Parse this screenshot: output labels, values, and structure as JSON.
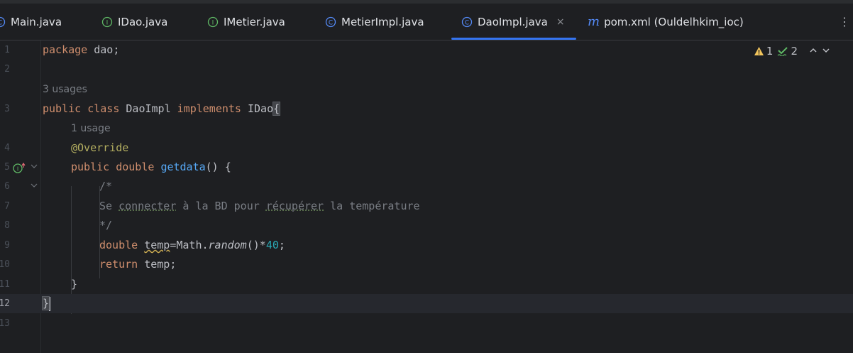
{
  "tabs": [
    {
      "label": "Main.java",
      "icon": "class-c-icon"
    },
    {
      "label": "IDao.java",
      "icon": "interface-i-icon"
    },
    {
      "label": "IMetier.java",
      "icon": "interface-i-icon"
    },
    {
      "label": "MetierImpl.java",
      "icon": "class-c-icon"
    },
    {
      "label": "DaoImpl.java",
      "icon": "class-c-icon",
      "active": true,
      "close": "×"
    },
    {
      "label": "pom.xml (Ouldelhkim_ioc)",
      "icon": "maven-m-icon",
      "prefix": "m"
    }
  ],
  "tab_menu": "⋮",
  "inspections": {
    "warnings": "1",
    "typos": "2"
  },
  "line_numbers": [
    "1",
    "2",
    "3",
    "4",
    "5",
    "6",
    "7",
    "8",
    "9",
    "10",
    "11",
    "12",
    "13"
  ],
  "hints": {
    "class_usages": "3 usages",
    "method_usages": "1 usage"
  },
  "code": {
    "l1": {
      "kw": "package",
      "rest": " dao;"
    },
    "l3": {
      "kw1": "public",
      "kw2": "class",
      "name": " DaoImpl ",
      "kw3": "implements",
      "iface": " IDao",
      "brace": "{"
    },
    "l4": {
      "ann": "@Override"
    },
    "l5": {
      "kw1": "public",
      "kw2": "double",
      "fn": "getdata",
      "rest": "() {"
    },
    "l6": {
      "text": "/*"
    },
    "l7": {
      "p1": "Se ",
      "w1": "connecter",
      "p2": " à la BD pour ",
      "w2": "récupérer",
      "p3": " la température"
    },
    "l8": {
      "text": "*/"
    },
    "l9": {
      "kw": "double",
      "var": "temp",
      "p1": "=Math.",
      "method": "random",
      "p2": "()*",
      "num": "40",
      "p3": ";"
    },
    "l10": {
      "kw": "return",
      "rest": " temp;"
    },
    "l11": {
      "text": "}"
    },
    "l12": {
      "text": "}"
    }
  },
  "colors": {
    "accent": "#3574f0",
    "keyword": "#cf8e6d",
    "function": "#56a8f5",
    "annotation": "#b3ae60",
    "number": "#2aacb8",
    "comment": "#7a7e85",
    "warning": "#f2c55c",
    "typo_check": "#5fb865"
  }
}
